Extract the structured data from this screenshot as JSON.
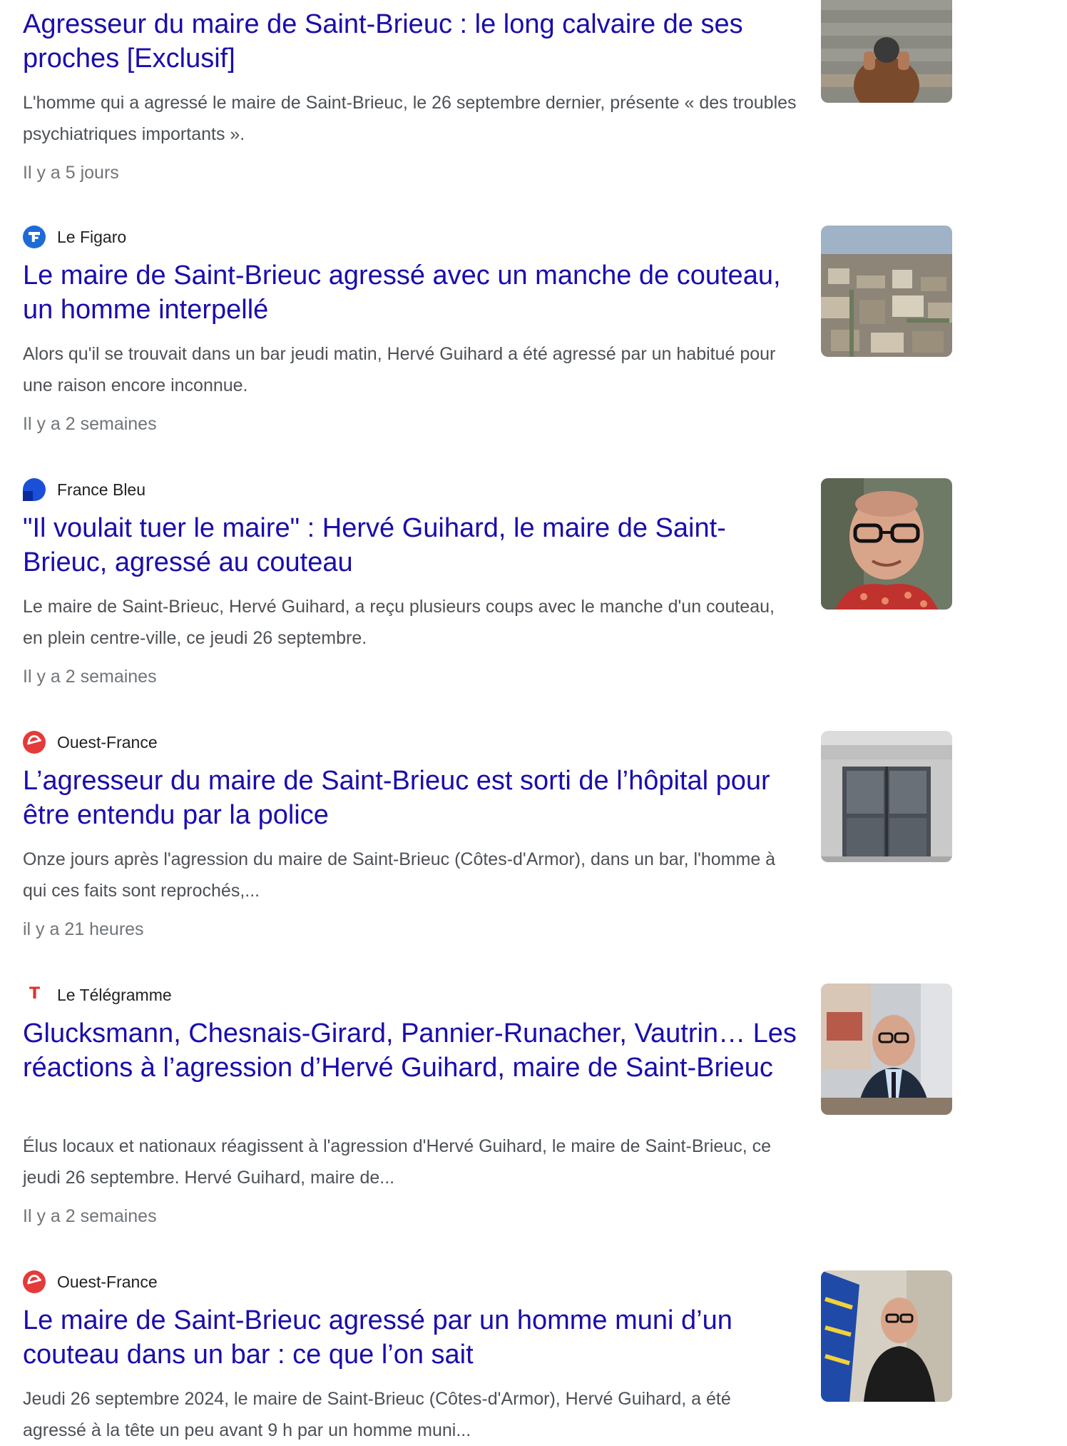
{
  "articles": [
    {
      "source": "",
      "title": "Agresseur du maire de Saint-Brieuc : le long calvaire de ses proches [Exclusif]",
      "snippet": "L'homme qui a agressé le maire de Saint-Brieuc, le 26 septembre dernier, présente « des troubles psychiatriques importants ».",
      "time": "Il y a 5 jours",
      "thumbnail": "photo-man-sitting-on-steps"
    },
    {
      "source": "Le Figaro",
      "favicon": "le-figaro-icon",
      "title": "Le maire de Saint-Brieuc agressé avec un manche de couteau, un homme interpellé",
      "snippet": "Alors qu'il se trouvait dans un bar jeudi matin, Hervé Guihard a été agressé par un habitué pour une raison encore inconnue.",
      "time": "Il y a 2 semaines",
      "thumbnail": "photo-aerial-city-view"
    },
    {
      "source": "France Bleu",
      "favicon": "france-bleu-icon",
      "title": "\"Il voulait tuer le maire\" : Hervé Guihard, le maire de Saint-Brieuc, agressé au couteau",
      "snippet": "Le maire de Saint-Brieuc, Hervé Guihard, a reçu plusieurs coups avec le manche d'un couteau, en plein centre-ville, ce jeudi 26 septembre.",
      "time": "Il y a 2 semaines",
      "thumbnail": "photo-portrait-man-glasses-red-scarf"
    },
    {
      "source": "Ouest-France",
      "favicon": "ouest-france-icon",
      "title": "L’agresseur du maire de Saint-Brieuc est sorti de l’hôpital pour être entendu par la police",
      "snippet": "Onze jours après l'agression du maire de Saint-Brieuc (Côtes-d'Armor), dans un bar, l'homme à qui ces faits sont reprochés,...",
      "time": "il y a 21 heures",
      "thumbnail": "photo-building-glass-entrance"
    },
    {
      "source": "Le Télégramme",
      "favicon": "le-telegramme-icon",
      "title": "Glucksmann, Chesnais-Girard, Pannier-Runacher, Vautrin… Les réactions à l’agression d’Hervé Guihard, maire de Saint-Brieuc",
      "snippet": "Élus locaux et nationaux réagissent à l'agression d'Hervé Guihard, le maire de Saint-Brieuc, ce jeudi 26 septembre. Hervé Guihard, maire de...",
      "time": "Il y a 2 semaines",
      "thumbnail": "photo-man-at-desk"
    },
    {
      "source": "Ouest-France",
      "favicon": "ouest-france-icon",
      "title": "Le maire de Saint-Brieuc agressé par un homme muni d’un couteau dans un bar : ce que l’on sait",
      "snippet": "Jeudi 26 septembre 2024, le maire de Saint-Brieuc (Côtes-d'Armor), Hervé Guihard, a été agressé à la tête un peu avant 9 h par un homme muni...",
      "time": "",
      "thumbnail": "photo-man-with-flag"
    }
  ]
}
